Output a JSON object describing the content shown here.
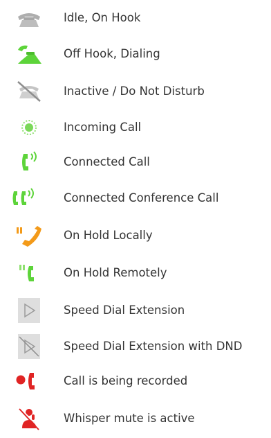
{
  "legend": {
    "items": [
      {
        "icon": "phone-idle-icon",
        "label": "Idle, On Hook"
      },
      {
        "icon": "phone-off-hook-icon",
        "label": "Off Hook, Dialing"
      },
      {
        "icon": "phone-dnd-icon",
        "label": "Inactive / Do Not Disturb"
      },
      {
        "icon": "incoming-call-icon",
        "label": "Incoming Call"
      },
      {
        "icon": "connected-call-icon",
        "label": "Connected Call"
      },
      {
        "icon": "conference-call-icon",
        "label": "Connected Conference Call"
      },
      {
        "icon": "hold-local-icon",
        "label": "On Hold Locally"
      },
      {
        "icon": "hold-remote-icon",
        "label": "On Hold Remotely"
      },
      {
        "icon": "speed-dial-icon",
        "label": "Speed Dial Extension"
      },
      {
        "icon": "speed-dial-dnd-icon",
        "label": "Speed Dial Extension with DND"
      },
      {
        "icon": "recording-icon",
        "label": "Call is being recorded"
      },
      {
        "icon": "whisper-mute-icon",
        "label": "Whisper mute is active"
      }
    ]
  },
  "colors": {
    "gray": "#b9b9b9",
    "gray_dark": "#8e8e8e",
    "green": "#5dd43a",
    "orange": "#f39a19",
    "red": "#e02424",
    "speed_dial_bg": "#dedede"
  }
}
